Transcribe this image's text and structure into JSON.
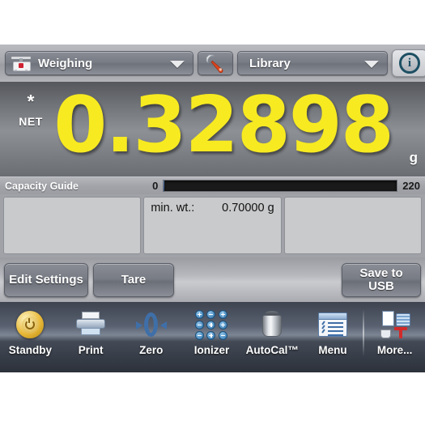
{
  "device": {
    "type": "laboratory-balance-touchscreen"
  },
  "topbar": {
    "mode_dropdown": {
      "value": "Weighing",
      "icon": "balance-icon",
      "caret": "chevron-down-icon"
    },
    "settings_button": {
      "icon": "wrench-icon",
      "label": ""
    },
    "library_dropdown": {
      "value": "Library",
      "caret": "chevron-down-icon"
    },
    "info_button": {
      "icon": "info-icon",
      "glyph": "i"
    }
  },
  "display": {
    "stability_indicator": "*",
    "net_indicator": "NET",
    "weight": "0.32898",
    "unit": "g"
  },
  "capacity": {
    "label": "Capacity Guide",
    "min": "0",
    "max": "220",
    "fill_percent": 0.15
  },
  "panels": [
    {
      "key": "",
      "value": ""
    },
    {
      "key": "min. wt.:",
      "value": "0.70000 g"
    },
    {
      "key": "",
      "value": ""
    }
  ],
  "actions": {
    "edit_settings": "Edit Settings",
    "tare": "Tare",
    "save_to_usb": "Save to\nUSB",
    "save_to_usb_line1": "Save to",
    "save_to_usb_line2": "USB"
  },
  "toolbar": {
    "items": [
      {
        "label": "Standby",
        "icon": "power-standby-icon"
      },
      {
        "label": "Print",
        "icon": "printer-icon"
      },
      {
        "label": "Zero",
        "icon": "zero-icon"
      },
      {
        "label": "Ionizer",
        "icon": "ionizer-icon"
      },
      {
        "label": "AutoCal™",
        "icon": "calibration-weight-icon"
      },
      {
        "label": "Menu",
        "icon": "menu-list-icon"
      },
      {
        "label": "More...",
        "icon": "more-applications-icon"
      }
    ],
    "divider_before_index": 6
  },
  "colors": {
    "weight_yellow": "#f7ea21",
    "display_gray": "#8d9095",
    "toolbar_dark": "#2c313a",
    "panel_gray": "#c9cacb",
    "chrome_gray": "#9a9ca1",
    "info_blue": "#1d4f63",
    "standby_gold": "#e8b93a",
    "accent_blue": "#3f6fa8",
    "accent_red": "#d12a2a"
  }
}
